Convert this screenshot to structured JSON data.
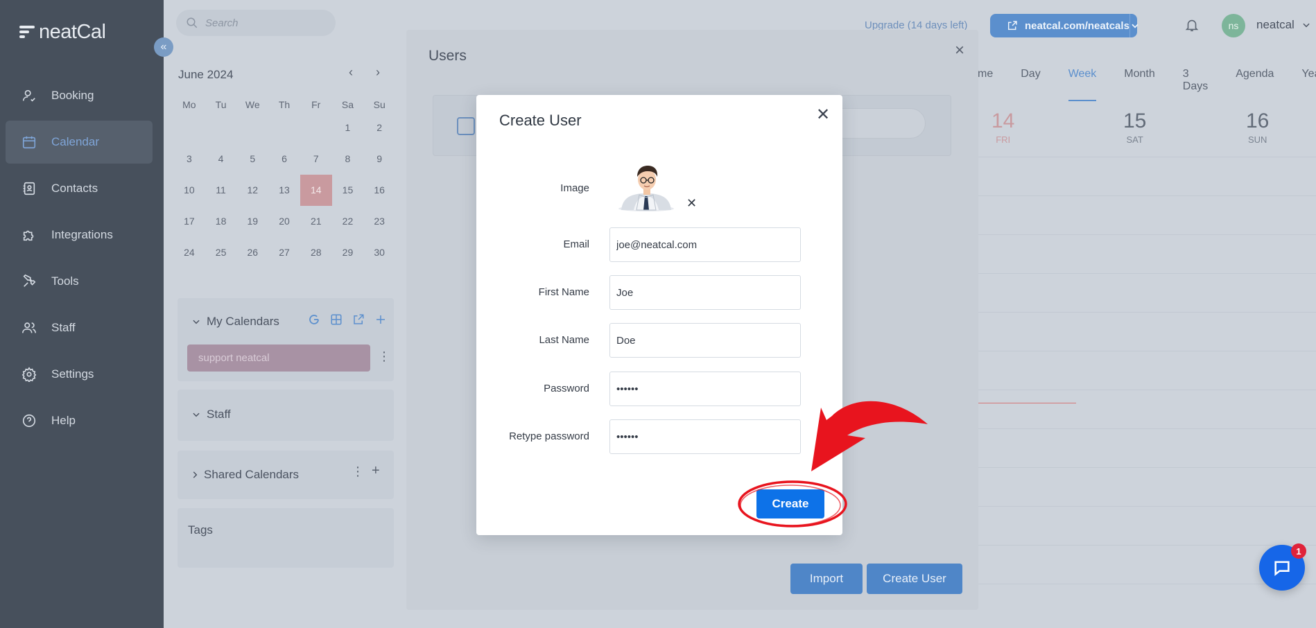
{
  "app": {
    "logo_text": "neatCal"
  },
  "sidebar": {
    "items": [
      {
        "label": "Booking",
        "icon": "user-check-icon"
      },
      {
        "label": "Calendar",
        "icon": "calendar-icon",
        "active": true
      },
      {
        "label": "Contacts",
        "icon": "contacts-icon"
      },
      {
        "label": "Integrations",
        "icon": "puzzle-icon"
      },
      {
        "label": "Tools",
        "icon": "wrench-icon"
      },
      {
        "label": "Staff",
        "icon": "users-icon"
      },
      {
        "label": "Settings",
        "icon": "gear-icon"
      },
      {
        "label": "Help",
        "icon": "help-icon"
      }
    ]
  },
  "topbar": {
    "search_placeholder": "Search",
    "upgrade_text": "Upgrade (14 days left)",
    "url_button": "neatcal.com/neatcals",
    "avatar_initials": "ns",
    "account_name": "neatcal"
  },
  "mini_calendar": {
    "month_label": "June 2024",
    "weekdays": [
      "Mo",
      "Tu",
      "We",
      "Th",
      "Fr",
      "Sa",
      "Su"
    ],
    "weeks": [
      [
        "",
        "",
        "",
        "",
        "",
        "1",
        "2"
      ],
      [
        "3",
        "4",
        "5",
        "6",
        "7",
        "8",
        "9"
      ],
      [
        "10",
        "11",
        "12",
        "13",
        "14",
        "15",
        "16"
      ],
      [
        "17",
        "18",
        "19",
        "20",
        "21",
        "22",
        "23"
      ],
      [
        "24",
        "25",
        "26",
        "27",
        "28",
        "29",
        "30"
      ]
    ],
    "today": "14"
  },
  "panels": {
    "my_calendars": "My Calendars",
    "calendar_item": "support neatcal",
    "staff": "Staff",
    "shared_calendars": "Shared Calendars",
    "tags": "Tags"
  },
  "calendar_view": {
    "tabs": [
      "me",
      "Day",
      "Week",
      "Month",
      "3 Days",
      "Agenda",
      "Year"
    ],
    "active_tab": "Week",
    "days": [
      {
        "num": "14",
        "name": "FRI",
        "today": true
      },
      {
        "num": "15",
        "name": "SAT"
      },
      {
        "num": "16",
        "name": "SUN"
      }
    ]
  },
  "users_modal": {
    "title": "Users",
    "import_button": "Import",
    "create_user_button": "Create User"
  },
  "create_user": {
    "title": "Create User",
    "image_label": "Image",
    "email_label": "Email",
    "email_value": "joe@neatcal.com",
    "first_name_label": "First Name",
    "first_name_value": "Joe",
    "last_name_label": "Last Name",
    "last_name_value": "Doe",
    "password_label": "Password",
    "password_value": "••••••",
    "retype_label": "Retype password",
    "retype_value": "••••••",
    "create_button": "Create"
  },
  "chat": {
    "badge_count": "1"
  },
  "colors": {
    "primary": "#0d72e8",
    "annotation_red": "#e8141e",
    "today_red": "#c99a9f"
  }
}
